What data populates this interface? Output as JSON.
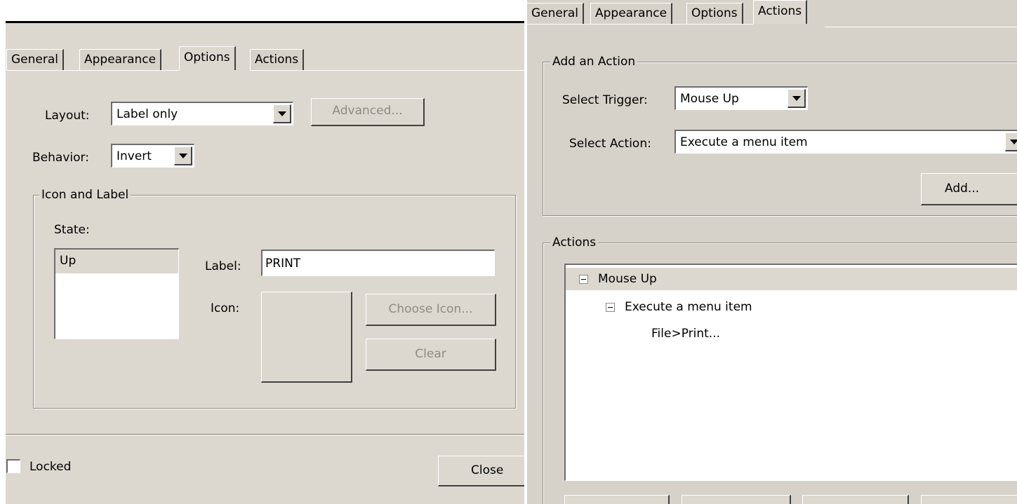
{
  "left_dialog": {
    "tabs": [
      "General",
      "Appearance",
      "Options",
      "Actions"
    ],
    "active_tab": "Options",
    "layout": {
      "label": "Layout:",
      "value": "Label only"
    },
    "advanced_button": "Advanced...",
    "behavior": {
      "label": "Behavior:",
      "value": "Invert"
    },
    "icon_and_label_group": {
      "title": "Icon and Label",
      "state_label": "State:",
      "state_items": [
        "Up"
      ],
      "label_field": {
        "label": "Label:",
        "value": "PRINT"
      },
      "icon_label": "Icon:",
      "choose_icon_button": "Choose Icon...",
      "clear_button": "Clear"
    },
    "locked": {
      "label": "Locked",
      "checked": false
    },
    "close_button": "Close"
  },
  "right_dialog": {
    "tabs": [
      "General",
      "Appearance",
      "Options",
      "Actions"
    ],
    "active_tab": "Actions",
    "add_action_group": {
      "title": "Add an Action",
      "trigger": {
        "label": "Select Trigger:",
        "value": "Mouse Up"
      },
      "action": {
        "label": "Select Action:",
        "value": "Execute a menu item"
      },
      "add_button": "Add..."
    },
    "actions_group": {
      "title": "Actions",
      "tree": [
        {
          "text": "Mouse Up",
          "level": 0,
          "expandable": true,
          "selected": true
        },
        {
          "text": "Execute a menu item",
          "level": 1,
          "expandable": true,
          "selected": false
        },
        {
          "text": "File>Print...",
          "level": 2,
          "expandable": false,
          "selected": false
        }
      ]
    }
  }
}
